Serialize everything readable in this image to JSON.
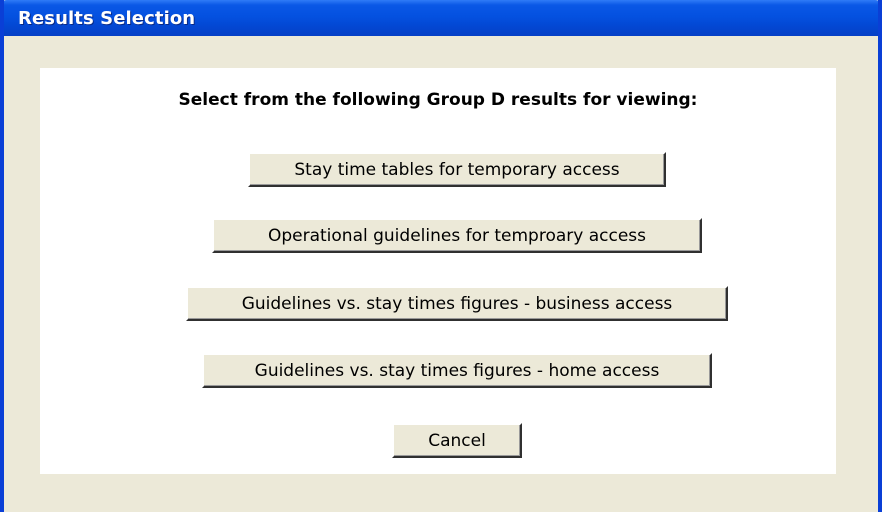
{
  "window": {
    "title": "Results Selection"
  },
  "dialog": {
    "prompt": "Select from the following Group D results for viewing:",
    "options": [
      "Stay time tables for temporary access",
      "Operational guidelines for temproary access",
      "Guidelines vs. stay times figures - business access",
      "Guidelines vs. stay times figures - home access"
    ],
    "cancel_label": "Cancel"
  },
  "colors": {
    "titlebar": "#0451e0",
    "window_frame": "#0a3fd6",
    "window_background": "#ece9d8",
    "content_background": "#ffffff",
    "button_face": "#ece9d8"
  }
}
